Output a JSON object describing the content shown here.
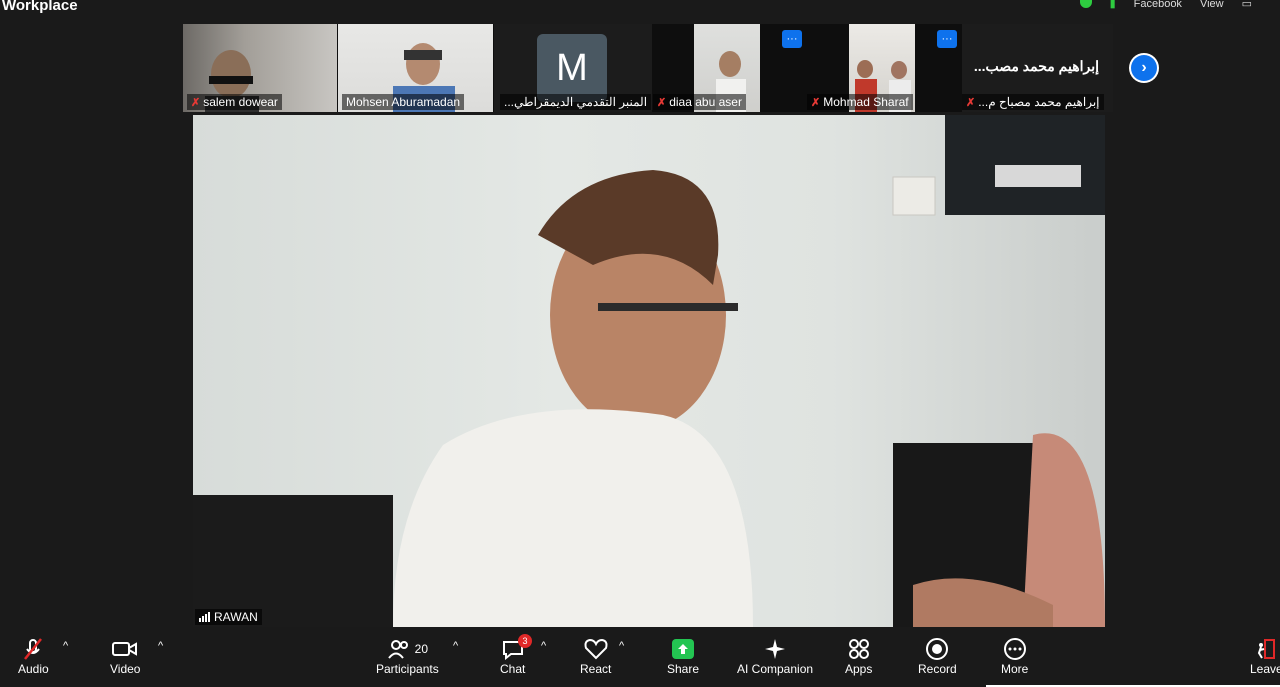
{
  "app": {
    "title": "Workplace"
  },
  "topbar": {
    "item1": "Facebook",
    "item2": "View"
  },
  "strip": {
    "tiles": [
      {
        "name": "salem dowear",
        "muted": true
      },
      {
        "name": "Mohsen Aburamadan",
        "muted": false
      },
      {
        "name": "...المنبر التقدمي الديمقراطي",
        "initial": "M",
        "muted": false
      },
      {
        "name": "diaa abu aser",
        "muted": true
      },
      {
        "name": "Mohmad Sharaf",
        "muted": true
      },
      {
        "name": "...إبراهيم محمد مصباح م",
        "display": "...إبراهيم محمد مصب",
        "muted": true
      }
    ],
    "menu_glyph": "···"
  },
  "main": {
    "speaker": "RAWAN"
  },
  "toolbar": {
    "audio": "Audio",
    "video": "Video",
    "participants": "Participants",
    "participants_count": "20",
    "chat": "Chat",
    "chat_badge": "3",
    "react": "React",
    "share": "Share",
    "ai": "AI Companion",
    "apps": "Apps",
    "record": "Record",
    "more": "More",
    "leave": "Leave"
  },
  "colors": {
    "accent": "#0e72ed",
    "share": "#23c552",
    "danger": "#e02828"
  }
}
